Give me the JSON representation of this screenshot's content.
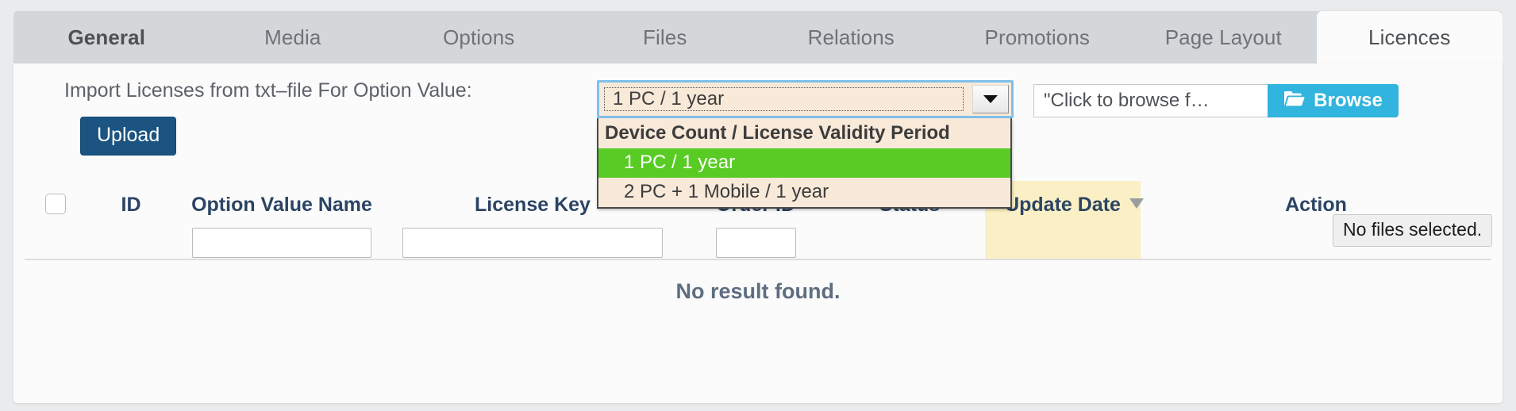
{
  "tabs": [
    {
      "label": "General",
      "active": false,
      "bold": true
    },
    {
      "label": "Media",
      "active": false,
      "bold": false
    },
    {
      "label": "Options",
      "active": false,
      "bold": false
    },
    {
      "label": "Files",
      "active": false,
      "bold": false
    },
    {
      "label": "Relations",
      "active": false,
      "bold": false
    },
    {
      "label": "Promotions",
      "active": false,
      "bold": false
    },
    {
      "label": "Page Layout",
      "active": false,
      "bold": false
    },
    {
      "label": "Licences",
      "active": true,
      "bold": false
    }
  ],
  "import": {
    "label": "Import Licenses from txt–file For Option Value:",
    "upload_label": "Upload",
    "select": {
      "value": "1 PC / 1 year",
      "open": true,
      "optgroup_label": "Device Count / License Validity Period",
      "options": [
        {
          "label": "1 PC / 1 year",
          "selected": true
        },
        {
          "label": "2 PC + 1 Mobile / 1 year",
          "selected": false
        }
      ],
      "highlight_color": "#58cc24",
      "background_color": "#f9e9d8",
      "focus_ring_color": "#7fc0ec"
    },
    "file": {
      "field_text": "\"Click to browse f…",
      "browse_label": "Browse",
      "browse_icon": "folder-open-icon",
      "browse_color": "#31b4dd",
      "status_text": "No files selected."
    }
  },
  "table": {
    "columns": [
      {
        "key": "select",
        "label": "",
        "icon": "checkbox-icon",
        "filter": false,
        "highlight": false,
        "sorted": false
      },
      {
        "key": "id",
        "label": "ID",
        "filter": false,
        "highlight": false,
        "sorted": false
      },
      {
        "key": "optname",
        "label": "Option Value Name",
        "filter": true,
        "highlight": false,
        "sorted": false
      },
      {
        "key": "key",
        "label": "License Key",
        "filter": true,
        "highlight": false,
        "sorted": false
      },
      {
        "key": "order",
        "label": "Order ID",
        "filter": true,
        "highlight": false,
        "sorted": false
      },
      {
        "key": "status",
        "label": "Status",
        "filter": false,
        "highlight": false,
        "sorted": false
      },
      {
        "key": "update",
        "label": "Update Date",
        "filter": false,
        "highlight": true,
        "sorted": true
      },
      {
        "key": "action",
        "label": "Action",
        "filter": false,
        "highlight": false,
        "sorted": false
      }
    ],
    "rows": [],
    "empty_message": "No result found.",
    "header_color": "#2b4463",
    "highlight_color": "#fbf0c5"
  }
}
